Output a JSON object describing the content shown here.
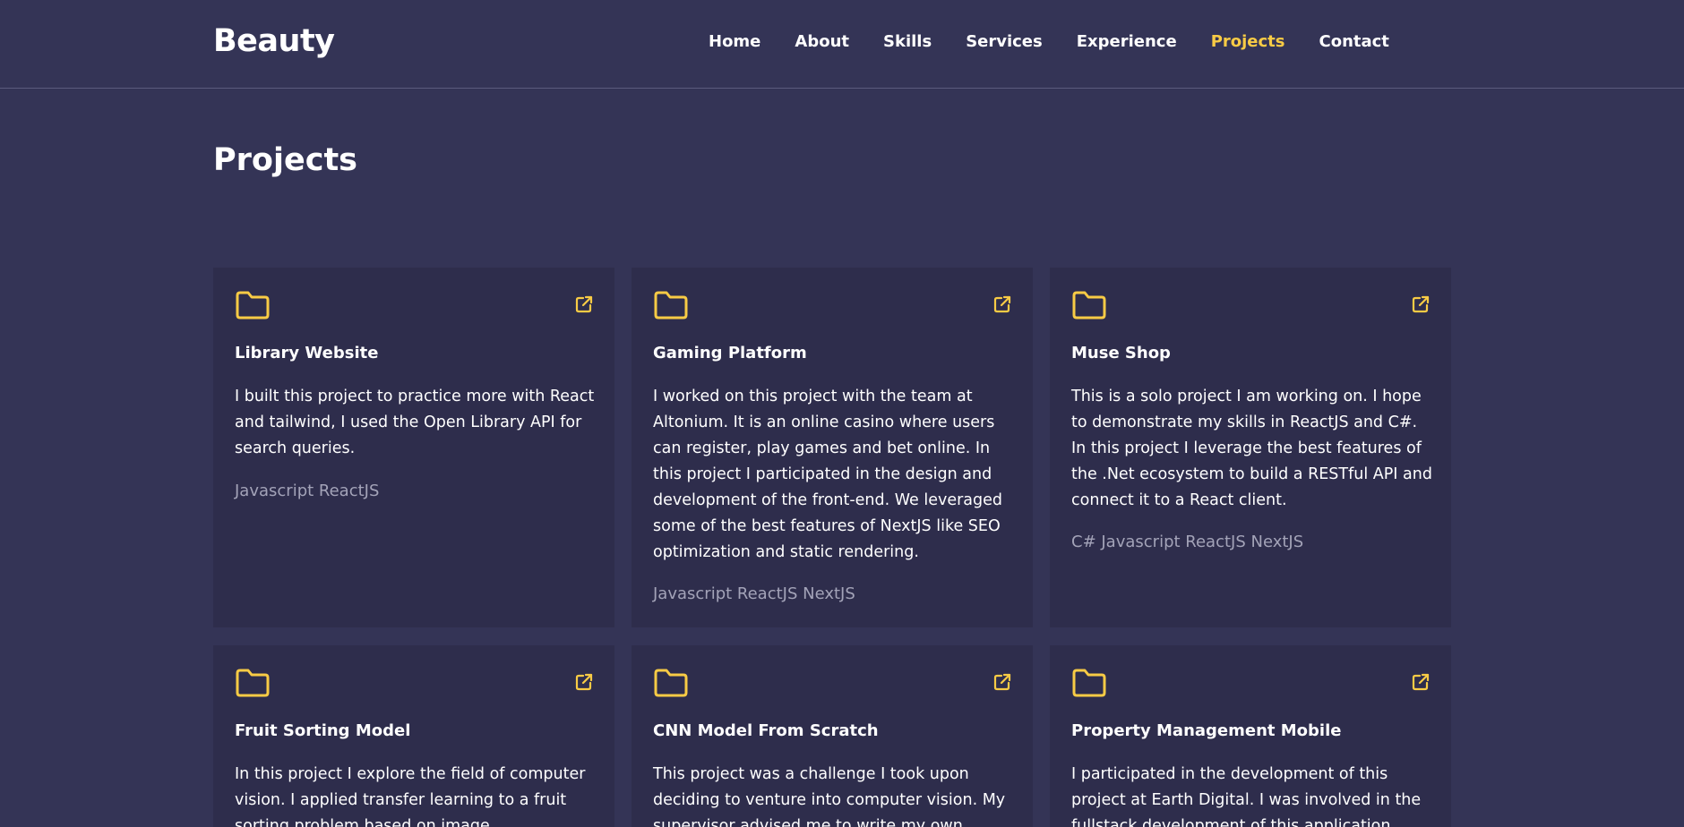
{
  "header": {
    "logo": "Beauty",
    "nav": [
      "Home",
      "About",
      "Skills",
      "Services",
      "Experience",
      "Projects",
      "Contact"
    ],
    "active_nav": "Projects"
  },
  "page": {
    "title": "Projects"
  },
  "colors": {
    "background": "#343456",
    "card": "#2e2d4c",
    "accent": "#f8cb45",
    "tags": "#a3a3b8"
  },
  "projects": [
    {
      "title": "Library Website",
      "description": "I built this project to practice more with React and tailwind, I used the Open Library API for search queries.",
      "tags": "Javascript ReactJS"
    },
    {
      "title": "Gaming Platform",
      "description": "I worked on this project with the team at Altonium. It is an online casino where users can register, play games and bet online. In this project I participated in the design and development of the front-end. We leveraged some of the best features of NextJS like SEO optimization and static rendering.",
      "tags": "Javascript ReactJS NextJS"
    },
    {
      "title": "Muse Shop",
      "description": "This is a solo project I am working on. I hope to demonstrate my skills in ReactJS and C#. In this project I leverage the best features of the .Net ecosystem to build a RESTful API and connect it to a React client.",
      "tags": "C# Javascript ReactJS NextJS"
    },
    {
      "title": "Fruit Sorting Model",
      "description": "In this project I explore the field of computer vision. I applied transfer learning to a fruit sorting problem based on image",
      "tags": ""
    },
    {
      "title": "CNN Model From Scratch",
      "description": "This project was a challenge I took upon deciding to venture into computer vision. My supervisor advised me to write my own",
      "tags": ""
    },
    {
      "title": "Property Management Mobile",
      "description": "I participated in the development of this project at Earth Digital. I was involved in the fullstack development of this application",
      "tags": ""
    }
  ],
  "icons": {
    "folder": "folder-icon",
    "external_link": "external-link-icon"
  }
}
